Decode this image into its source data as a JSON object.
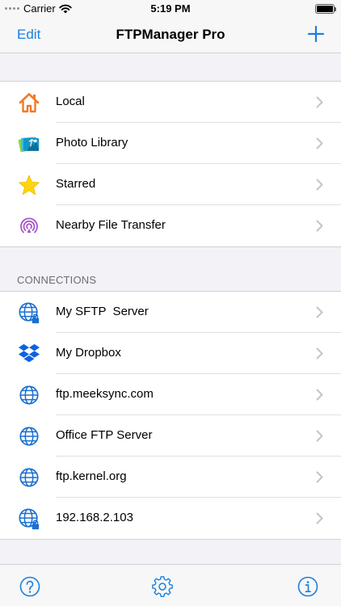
{
  "status_bar": {
    "carrier": "Carrier",
    "time": "5:19 PM"
  },
  "nav": {
    "edit_label": "Edit",
    "title": "FTPManager Pro",
    "add_icon": "plus-icon"
  },
  "locations": [
    {
      "label": "Local",
      "icon": "house-icon"
    },
    {
      "label": "Photo Library",
      "icon": "photos-icon"
    },
    {
      "label": "Starred",
      "icon": "star-icon"
    },
    {
      "label": "Nearby File Transfer",
      "icon": "airdrop-icon"
    }
  ],
  "connections_header": "CONNECTIONS",
  "connections": [
    {
      "label": "My SFTP  Server",
      "icon": "globe-lock-icon"
    },
    {
      "label": "My Dropbox",
      "icon": "dropbox-icon"
    },
    {
      "label": "ftp.meeksync.com",
      "icon": "globe-icon"
    },
    {
      "label": "Office FTP Server",
      "icon": "globe-icon"
    },
    {
      "label": "ftp.kernel.org",
      "icon": "globe-icon"
    },
    {
      "label": "192.168.2.103",
      "icon": "globe-lock-icon"
    }
  ],
  "tab_bar": {
    "help_icon": "question-icon",
    "settings_icon": "gear-icon",
    "info_icon": "info-icon"
  },
  "colors": {
    "accent": "#1a7fe0",
    "house": "#f07a27",
    "star": "#ffd60a",
    "airdrop": "#a855c9",
    "dropbox": "#0d62e0"
  }
}
